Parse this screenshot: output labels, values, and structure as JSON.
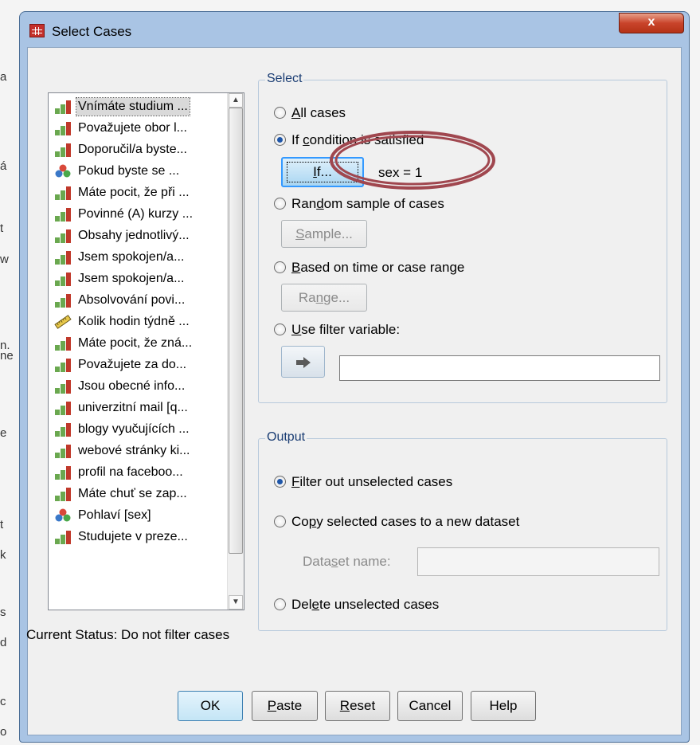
{
  "window": {
    "title": "Select Cases",
    "close_label": "x"
  },
  "variables": [
    {
      "label": "Vnímáte studium ...",
      "icon": "scale-bar-icon",
      "selected": true
    },
    {
      "label": "Považujete obor l...",
      "icon": "scale-bar-icon"
    },
    {
      "label": "Doporučil/a byste...",
      "icon": "scale-bar-icon"
    },
    {
      "label": "Pokud byste se ...",
      "icon": "nominal-icon"
    },
    {
      "label": "Máte pocit, že při ...",
      "icon": "scale-bar-icon"
    },
    {
      "label": "Povinné (A) kurzy ...",
      "icon": "scale-bar-icon"
    },
    {
      "label": "Obsahy jednotlivý...",
      "icon": "scale-bar-icon"
    },
    {
      "label": "Jsem spokojen/a...",
      "icon": "scale-bar-icon"
    },
    {
      "label": "Jsem spokojen/a...",
      "icon": "scale-bar-icon"
    },
    {
      "label": "Absolvování povi...",
      "icon": "scale-bar-icon"
    },
    {
      "label": "Kolik hodin týdně ...",
      "icon": "ruler-icon"
    },
    {
      "label": "Máte pocit, že zná...",
      "icon": "scale-bar-icon"
    },
    {
      "label": "Považujete za do...",
      "icon": "scale-bar-icon"
    },
    {
      "label": "Jsou obecné info...",
      "icon": "scale-bar-icon"
    },
    {
      "label": "univerzitní mail [q...",
      "icon": "scale-bar-icon"
    },
    {
      "label": "blogy vyučujících ...",
      "icon": "scale-bar-icon"
    },
    {
      "label": "webové stránky ki...",
      "icon": "scale-bar-icon"
    },
    {
      "label": "profil na faceboo...",
      "icon": "scale-bar-icon"
    },
    {
      "label": "Máte chuť se zap...",
      "icon": "scale-bar-icon"
    },
    {
      "label": "Pohlaví [sex]",
      "icon": "nominal-icon"
    },
    {
      "label": "Studujete v preze...",
      "icon": "scale-bar-icon"
    }
  ],
  "select_group": {
    "legend": "Select",
    "all_cases": {
      "pre": "",
      "key": "A",
      "post": "ll cases"
    },
    "if_condition": {
      "pre": "If ",
      "key": "c",
      "post": "ondition is satisfied"
    },
    "if_button": {
      "key": "I",
      "post": "f..."
    },
    "condition_value": "sex = 1",
    "random_sample": {
      "pre": "Ran",
      "key": "d",
      "post": "om sample of cases"
    },
    "sample_button": {
      "key": "S",
      "post": "ample..."
    },
    "time_range": {
      "pre": "",
      "key": "B",
      "post": "ased on time or case range"
    },
    "range_button": {
      "pre": "Ra",
      "key": "n",
      "post": "ge..."
    },
    "filter_variable": {
      "pre": "",
      "key": "U",
      "post": "se filter variable:"
    },
    "filter_value": "",
    "selected": "if_condition"
  },
  "output_group": {
    "legend": "Output",
    "filter_out": {
      "pre": "",
      "key": "F",
      "post": "ilter out unselected cases"
    },
    "copy_new": {
      "pre": "Co",
      "key": "p",
      "post": "y selected cases to a new dataset"
    },
    "dataset_name": {
      "pre": "Data",
      "key": "s",
      "post": "et name:"
    },
    "dataset_value": "",
    "delete": {
      "pre": "Del",
      "key": "e",
      "post": "te unselected cases"
    },
    "selected": "filter_out"
  },
  "status_text": "Current Status: Do not filter cases",
  "buttons": {
    "ok": "OK",
    "paste": {
      "key": "P",
      "post": "aste"
    },
    "reset": {
      "key": "R",
      "post": "eset"
    },
    "cancel": "Cancel",
    "help": "Help"
  },
  "background_letters": [
    "a",
    "á",
    "t",
    "w",
    "n.",
    "ne",
    "e",
    "t",
    "k",
    "s",
    "d",
    "c",
    "o"
  ],
  "colors": {
    "title_bar": "#a9c4e4",
    "close_button": "#c9442b",
    "group_legend": "#1a3d73",
    "highlight_ellipse": "#a0474f"
  }
}
